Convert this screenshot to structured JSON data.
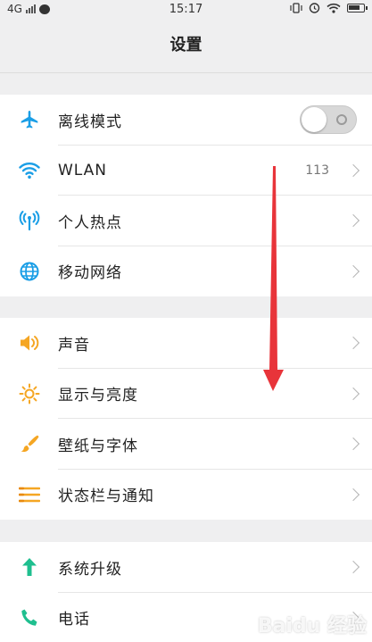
{
  "status_bar": {
    "network": "4G",
    "time": "15:17"
  },
  "title": "设置",
  "groups": [
    {
      "items": [
        {
          "label": "离线模式",
          "icon": "airplane-icon",
          "control": "toggle",
          "toggle_on": false
        },
        {
          "label": "WLAN",
          "icon": "wifi-icon",
          "value": "113"
        },
        {
          "label": "个人热点",
          "icon": "hotspot-icon"
        },
        {
          "label": "移动网络",
          "icon": "globe-icon"
        }
      ]
    },
    {
      "items": [
        {
          "label": "声音",
          "icon": "speaker-icon"
        },
        {
          "label": "显示与亮度",
          "icon": "sun-icon"
        },
        {
          "label": "壁纸与字体",
          "icon": "brush-icon"
        },
        {
          "label": "状态栏与通知",
          "icon": "list-icon"
        }
      ]
    },
    {
      "items": [
        {
          "label": "系统升级",
          "icon": "up-arrow-icon"
        },
        {
          "label": "电话",
          "icon": "phone-icon"
        }
      ]
    }
  ],
  "colors": {
    "blue": "#1a9ee6",
    "orange": "#f5a623",
    "green": "#1fbf8f",
    "annotation_red": "#e8343a"
  },
  "watermark": "Baidu 经验"
}
